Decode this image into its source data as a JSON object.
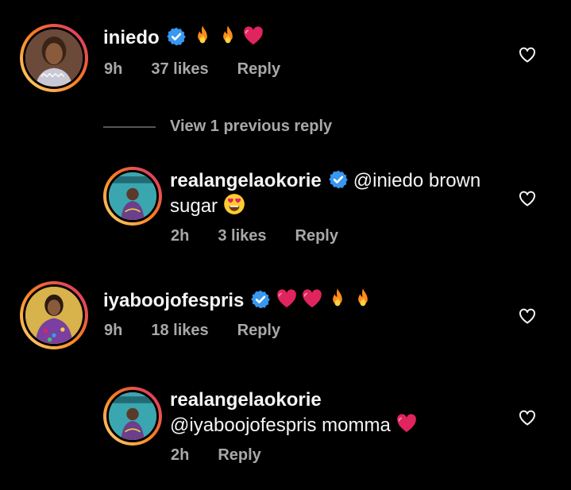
{
  "colors": {
    "background": "#000000",
    "text": "#f5f5f5",
    "meta": "#a8a8a8",
    "verified_badge": "#3897f0",
    "story_ring_start": "#feda75",
    "story_ring_end": "#d62976",
    "heart_emoji": "#e0245e"
  },
  "comments": [
    {
      "username": "iniedo",
      "verified": true,
      "body": "",
      "emojis": [
        "fire-emoji",
        "fire-emoji",
        "red-heart-emoji"
      ],
      "time": "9h",
      "likes": "37 likes",
      "reply_label": "Reply",
      "view_replies_label": "View 1 previous reply",
      "replies": [
        {
          "username": "realangelaokorie",
          "verified": true,
          "body_line1": "@iniedo brown",
          "body_line2": "sugar",
          "emojis": [
            "heart-eyes-emoji"
          ],
          "time": "2h",
          "likes": "3 likes",
          "reply_label": "Reply"
        }
      ]
    },
    {
      "username": "iyaboojofespris",
      "verified": true,
      "body": "",
      "emojis": [
        "red-heart-emoji",
        "red-heart-emoji",
        "fire-emoji",
        "fire-emoji"
      ],
      "time": "9h",
      "likes": "18 likes",
      "reply_label": "Reply",
      "replies": [
        {
          "username": "realangelaokorie",
          "verified": false,
          "body_line1": "@iyaboojofespris momma",
          "emojis": [
            "red-heart-emoji"
          ],
          "time": "2h",
          "reply_label": "Reply"
        }
      ]
    }
  ]
}
